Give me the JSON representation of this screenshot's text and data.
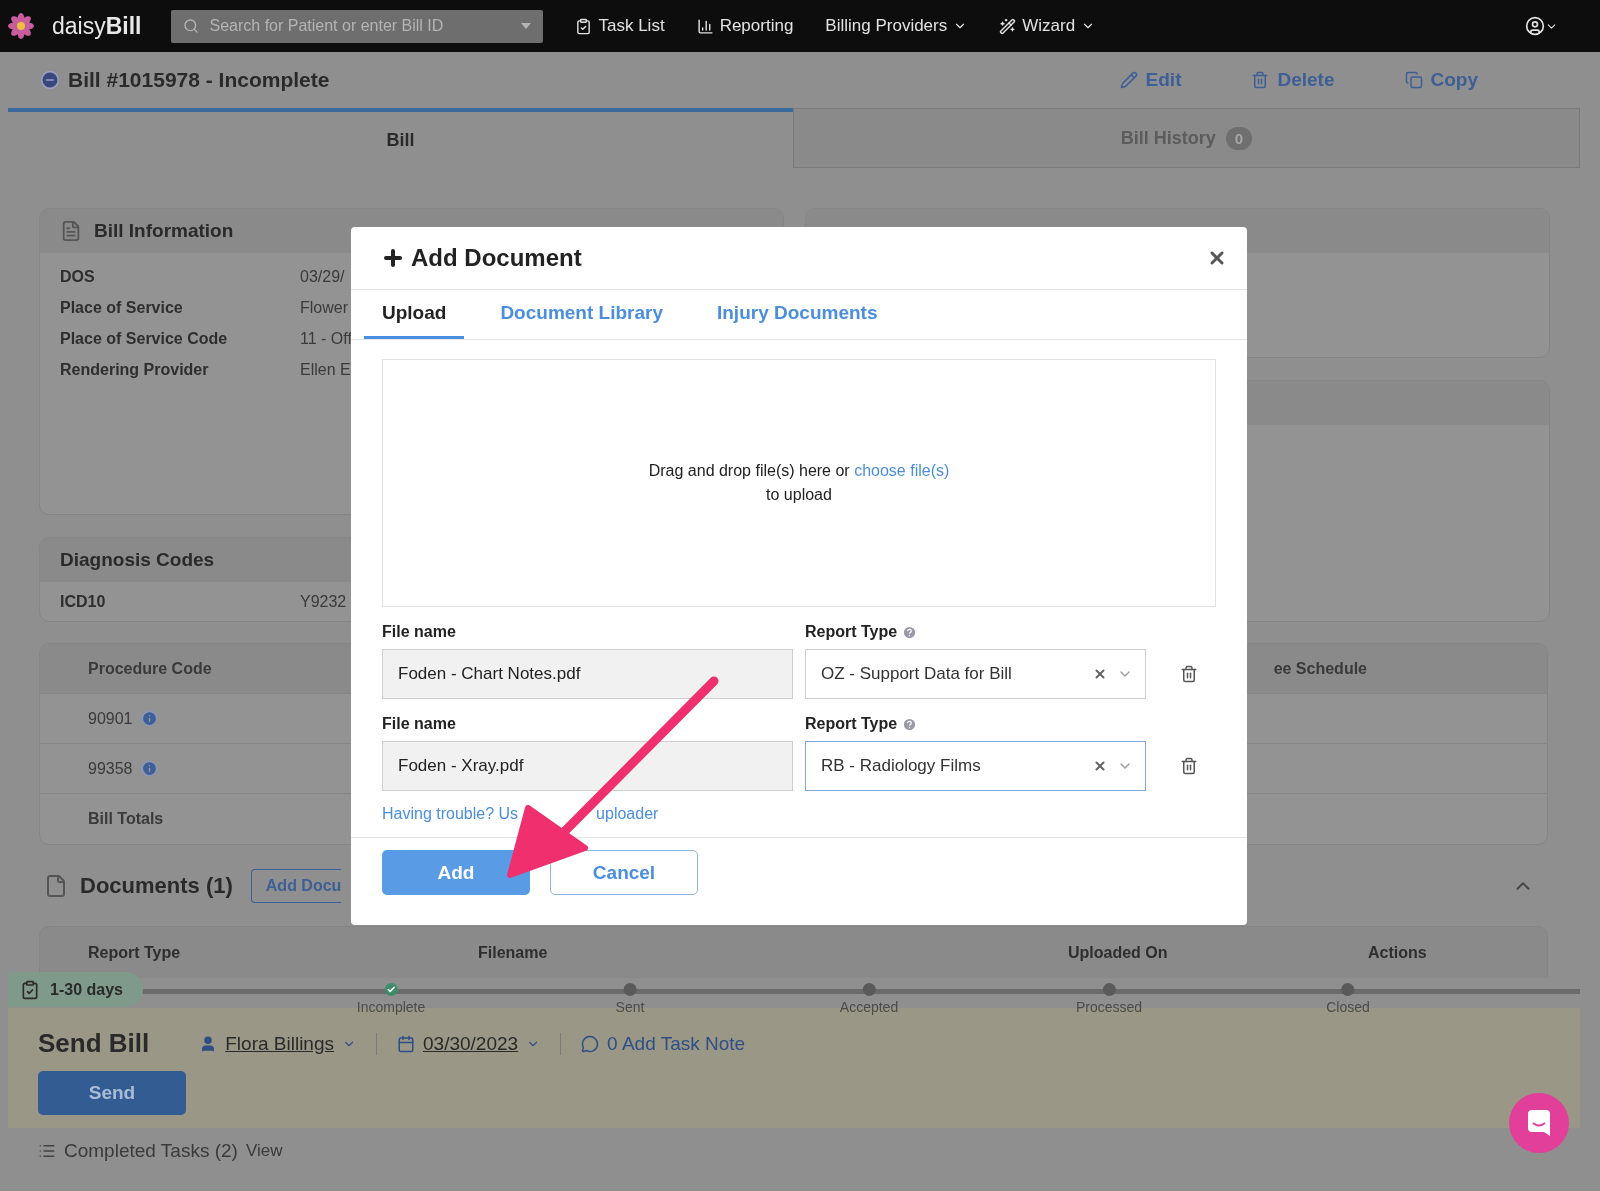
{
  "nav": {
    "brand": "daisy**Bill**",
    "search": {
      "placeholder": "Search for Patient or enter Bill ID"
    },
    "items": [
      {
        "label": "Task List",
        "dropdown": false
      },
      {
        "label": "Reporting",
        "dropdown": false
      },
      {
        "label": "Billing Providers",
        "dropdown": true
      },
      {
        "label": "Wizard",
        "dropdown": true
      }
    ]
  },
  "bill": {
    "title": "Bill #1015978 - Incomplete",
    "actions": [
      "Edit",
      "Delete",
      "Copy"
    ]
  },
  "tabs": [
    {
      "label": "Bill",
      "selected": true
    },
    {
      "label": "Bill History",
      "selected": false,
      "badge": "0"
    }
  ],
  "bill_information": {
    "title": "Bill Information",
    "rows": [
      {
        "label": "DOS",
        "value": "03/29/"
      },
      {
        "label": "Place of Service",
        "value": "Flower"
      },
      {
        "label": "Place of Service Code",
        "value": "11 - Off"
      },
      {
        "label": "Rendering Provider",
        "value": "Ellen E"
      }
    ]
  },
  "diagnosis_codes": {
    "title": "Diagnosis Codes",
    "rows": [
      {
        "label": "ICD10",
        "value": "Y9232"
      }
    ]
  },
  "procedures": {
    "column_1": "Procedure Code",
    "column_2": "ee Schedule",
    "rows": [
      "90901",
      "99358"
    ],
    "totals": "Bill Totals"
  },
  "documents": {
    "title": "Documents (1)",
    "add_button": "Add Docu",
    "columns": [
      "Report Type",
      "Filename",
      "Uploaded On",
      "Actions"
    ]
  },
  "workflow": {
    "age": "1-30 days",
    "steps": [
      {
        "label": "Incomplete",
        "done": true
      },
      {
        "label": "Sent",
        "done": false
      },
      {
        "label": "Accepted",
        "done": false
      },
      {
        "label": "Processed",
        "done": false
      },
      {
        "label": "Closed",
        "done": false
      }
    ]
  },
  "send": {
    "title": "Send Bill",
    "assignee": "Flora Billings",
    "date": "03/30/2023",
    "note": "0 Add Task Note",
    "button": "Send"
  },
  "completed": {
    "label": "Completed Tasks (2)",
    "link": "View"
  },
  "modal": {
    "title": "Add Document",
    "tabs": [
      {
        "label": "Upload",
        "selected": true
      },
      {
        "label": "Document Library",
        "selected": false
      },
      {
        "label": "Injury Documents",
        "selected": false
      }
    ],
    "dropzone": {
      "text": "Drag and drop file(s) here or",
      "link": "choose file(s)",
      "text_2": "to upload"
    },
    "files": [
      {
        "file_label": "File name",
        "file_name": "Foden - Chart Notes.pdf",
        "type_label": "Report Type",
        "report_type": "OZ - Support Data for Bill",
        "focused": false
      },
      {
        "file_label": "File name",
        "file_name": "Foden - Xray.pdf",
        "type_label": "Report Type",
        "report_type": "RB - Radiology Films",
        "focused": true
      }
    ],
    "help_link": "Having trouble? Us",
    "help_link_2": "uploader",
    "buttons": [
      {
        "label": "Add",
        "kind": "primary"
      },
      {
        "label": "Cancel",
        "kind": "secondary"
      }
    ]
  }
}
